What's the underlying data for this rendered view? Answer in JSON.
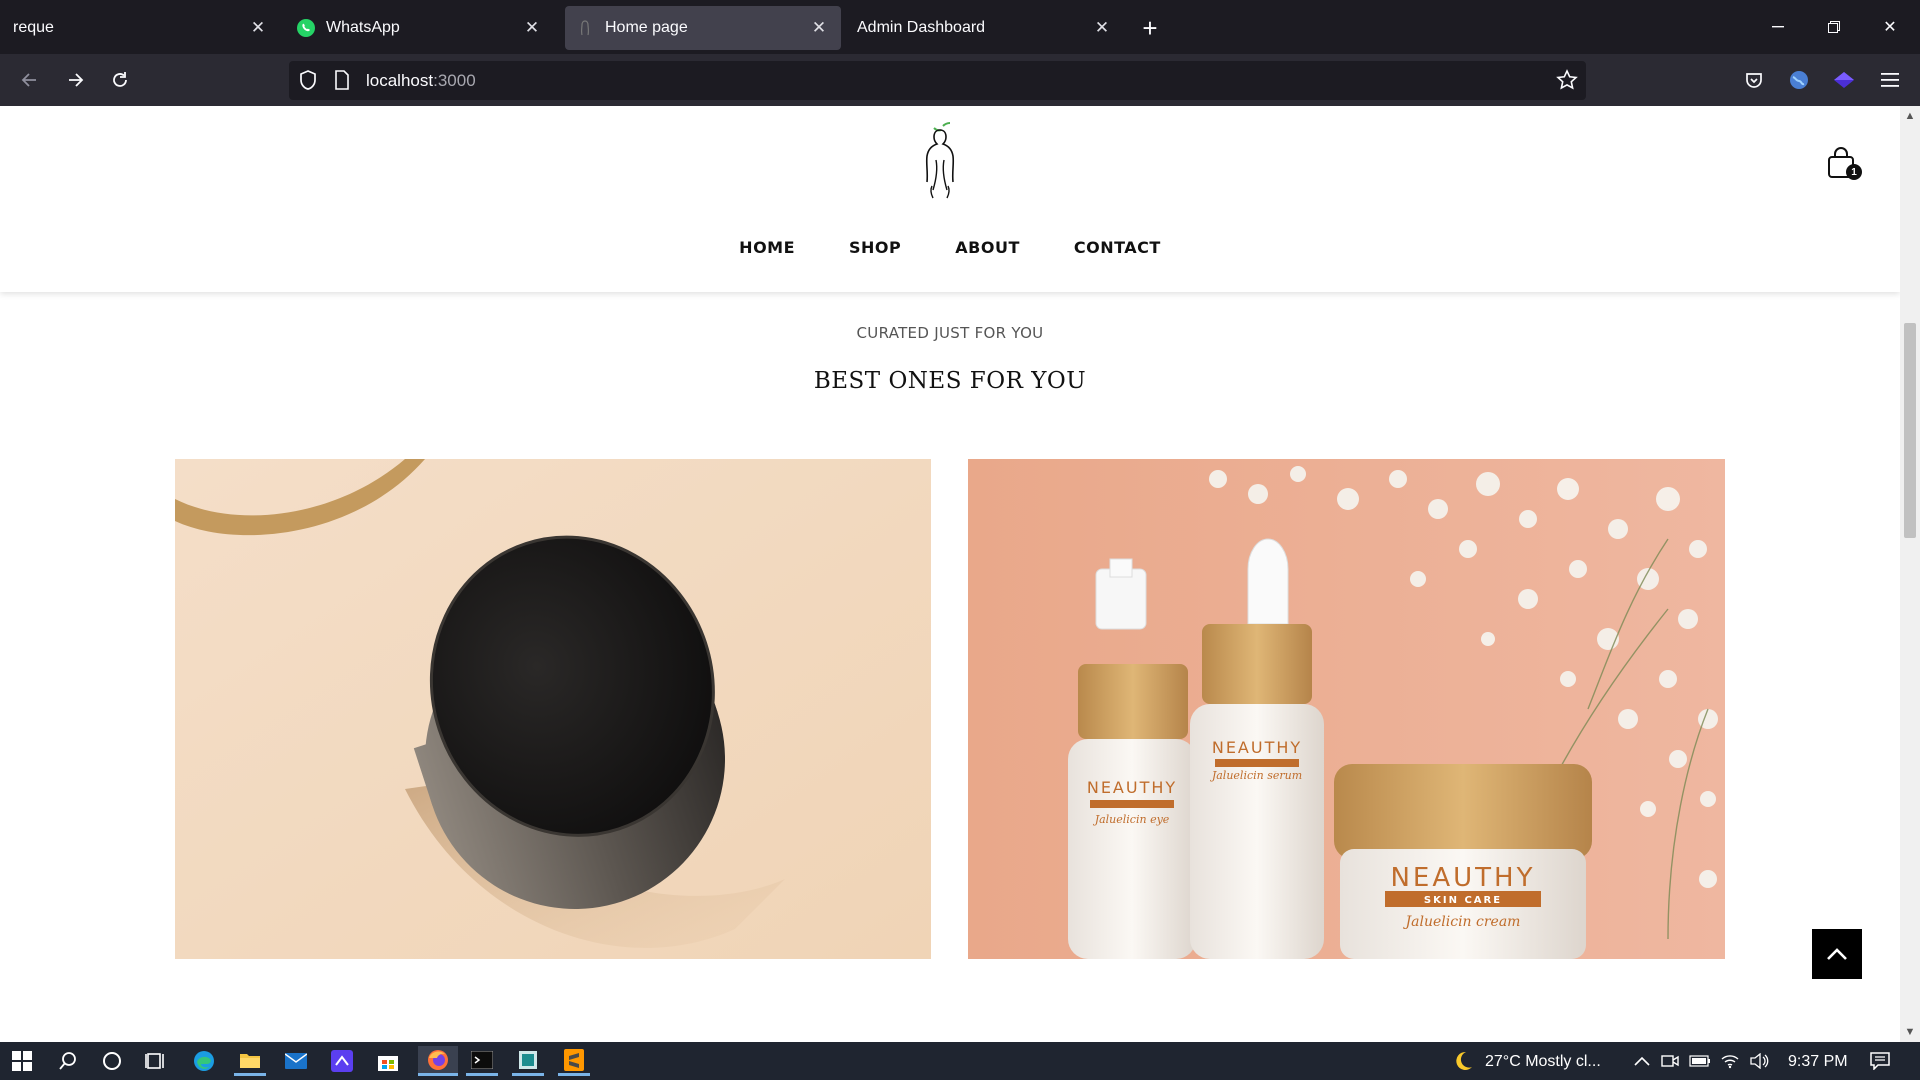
{
  "browser": {
    "tabs": [
      {
        "title": "reque",
        "active": false
      },
      {
        "title": "WhatsApp",
        "active": false,
        "icon": "whatsapp-icon"
      },
      {
        "title": "Home page",
        "active": true,
        "icon": "page-favicon"
      },
      {
        "title": "Admin Dashboard",
        "active": false
      }
    ],
    "url_host": "localhost",
    "url_port": ":3000"
  },
  "site": {
    "nav": [
      "HOME",
      "SHOP",
      "ABOUT",
      "CONTACT"
    ],
    "cart_count": "1",
    "section_kicker": "CURATED JUST FOR YOU",
    "section_title": "BEST ONES FOR YOU"
  },
  "products": {
    "brand": "NEAUTHY",
    "brand_sub": "SKIN CARE",
    "bottle1_label": "Jaluelicin eye",
    "bottle2_label": "Jaluelicin serum",
    "jar_label": "Jaluelicin cream"
  },
  "taskbar": {
    "weather": "27°C  Mostly cl...",
    "time": "9:37 PM"
  },
  "colors": {
    "accent_orange": "#c06d2c",
    "card1_bg": "#f2d9c0",
    "card2_bg": "#e8a488"
  }
}
